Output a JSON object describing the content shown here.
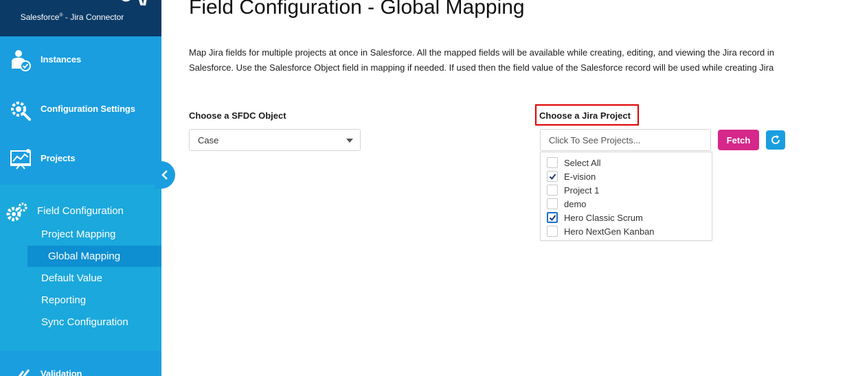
{
  "sidebar": {
    "brand_subtitle": "Salesforce",
    "brand_subtitle_mark": "®",
    "brand_subtitle_suffix": " - Jira Connector",
    "items": [
      {
        "label": "Instances",
        "icon": "user-check-icon"
      },
      {
        "label": "Configuration Settings",
        "icon": "wrench-gear-icon"
      },
      {
        "label": "Projects",
        "icon": "chart-board-icon"
      }
    ],
    "field_configuration": {
      "label": "Field Configuration",
      "icon": "gears-icon",
      "sub_items": [
        {
          "label": "Project Mapping"
        },
        {
          "label": "Global Mapping",
          "active": true
        },
        {
          "label": "Default Value"
        },
        {
          "label": "Reporting"
        },
        {
          "label": "Sync Configuration"
        }
      ]
    },
    "bottom_item": {
      "label": "Validation",
      "icon": "double-check-icon"
    },
    "collapse_icon": "chevron-left-icon"
  },
  "main": {
    "title": "Field Configuration - Global Mapping",
    "description": "Map Jira fields for multiple projects at once in Salesforce. All the mapped fields will be available while creating, editing, and viewing the Jira record in Salesforce. Use the Salesforce Object field in mapping if needed. If used then the field value of the Salesforce record will be used while creating Jira",
    "sfdc_object": {
      "label": "Choose a SFDC Object",
      "value": "Case"
    },
    "jira_project": {
      "label": "Choose a Jira Project",
      "placeholder": "Click To See Projects...",
      "fetch_label": "Fetch",
      "refresh_icon": "refresh-icon",
      "options": [
        {
          "label": "Select All",
          "checked": false
        },
        {
          "label": "E-vision",
          "checked": true
        },
        {
          "label": "Project 1",
          "checked": false
        },
        {
          "label": "demo",
          "checked": false
        },
        {
          "label": "Hero Classic Scrum",
          "checked": true,
          "focused": true
        },
        {
          "label": "Hero NextGen Kanban",
          "checked": false
        }
      ]
    }
  },
  "colors": {
    "sidebar_bg": "#1ba8dc",
    "brand_bg": "#0b3a66",
    "active_bg": "#0d8fd1",
    "fetch_button": "#d6278a",
    "refresh_button": "#1a9ee0",
    "highlight_border": "#e00000"
  }
}
